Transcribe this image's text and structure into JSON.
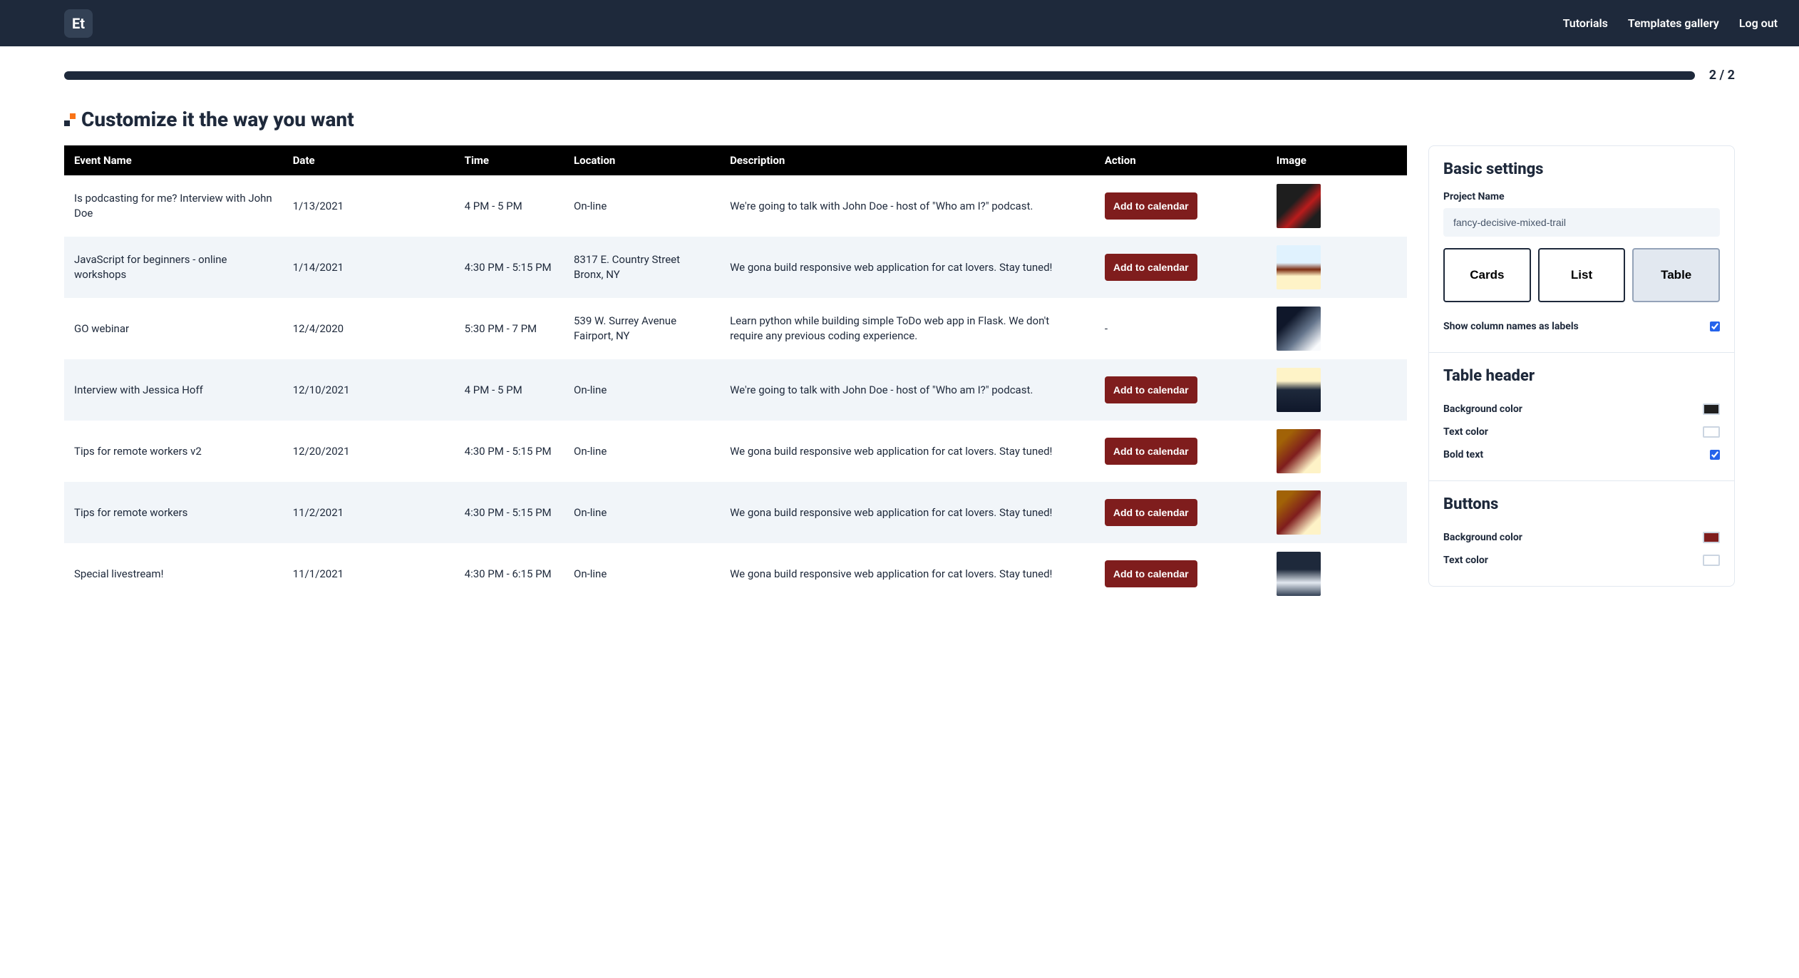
{
  "nav": {
    "logo": "Et",
    "links": [
      "Tutorials",
      "Templates gallery",
      "Log out"
    ]
  },
  "progress": {
    "text": "2 / 2"
  },
  "heading": "Customize it the way you want",
  "table": {
    "headers": [
      "Event Name",
      "Date",
      "Time",
      "Location",
      "Description",
      "Action",
      "Image"
    ],
    "rows": [
      {
        "event": "Is podcasting for me? Interview with John Doe",
        "date": "1/13/2021",
        "time": "4 PM - 5 PM",
        "location": "On-line",
        "description": "We're going to talk with John Doe - host of \"Who am I?\" podcast.",
        "action": "Add to calendar",
        "imgClass": "img-mic"
      },
      {
        "event": "JavaScript for beginners - online workshops",
        "date": "1/14/2021",
        "time": "4:30 PM - 5:15 PM",
        "location": "8317 E. Country Street Bronx, NY",
        "description": "We gona build responsive web application for cat lovers. Stay tuned!",
        "action": "Add to calendar",
        "imgClass": "img-office"
      },
      {
        "event": "GO webinar",
        "date": "12/4/2020",
        "time": "5:30 PM - 7 PM",
        "location": "539 W. Surrey Avenue Fairport, NY",
        "description": "Learn python while building simple ToDo web app in Flask. We don't require any previous coding experience.",
        "action": "-",
        "imgClass": "img-code"
      },
      {
        "event": "Interview with Jessica Hoff",
        "date": "12/10/2021",
        "time": "4 PM - 5 PM",
        "location": "On-line",
        "description": "We're going to talk with John Doe - host of \"Who am I?\" podcast.",
        "action": "Add to calendar",
        "imgClass": "img-room"
      },
      {
        "event": "Tips for remote workers v2",
        "date": "12/20/2021",
        "time": "4:30 PM - 5:15 PM",
        "location": "On-line",
        "description": "We gona build responsive web application for cat lovers. Stay tuned!",
        "action": "Add to calendar",
        "imgClass": "img-remote"
      },
      {
        "event": "Tips for remote workers",
        "date": "11/2/2021",
        "time": "4:30 PM - 5:15 PM",
        "location": "On-line",
        "description": "We gona build responsive web application for cat lovers. Stay tuned!",
        "action": "Add to calendar",
        "imgClass": "img-remote"
      },
      {
        "event": "Special livestream!",
        "date": "11/1/2021",
        "time": "4:30 PM - 6:15 PM",
        "location": "On-line",
        "description": "We gona build responsive web application for cat lovers. Stay tuned!",
        "action": "Add to calendar",
        "imgClass": "img-stage"
      }
    ]
  },
  "sidebar": {
    "basic": {
      "title": "Basic settings",
      "projectNameLabel": "Project Name",
      "projectNameValue": "fancy-decisive-mixed-trail",
      "views": [
        "Cards",
        "List",
        "Table"
      ],
      "activeView": "Table",
      "showColumnLabel": "Show column names as labels",
      "showColumnChecked": true
    },
    "tableHeader": {
      "title": "Table header",
      "bgLabel": "Background color",
      "bgColor": "#1f1f1f",
      "textLabel": "Text color",
      "textColor": "#ffffff",
      "boldLabel": "Bold text",
      "boldChecked": true
    },
    "buttons": {
      "title": "Buttons",
      "bgLabel": "Background color",
      "bgColor": "#7f1d1d",
      "textLabel": "Text color",
      "textColor": "#ffffff"
    }
  }
}
